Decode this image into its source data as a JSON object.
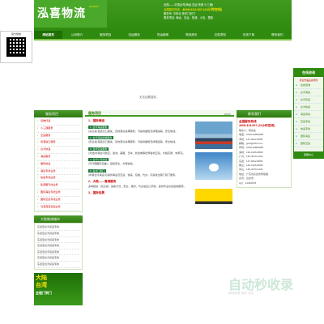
{
  "header": {
    "logo": "泓喜物流",
    "logo_sub": "HONGXI",
    "line1": "全国——中国台湾(海运 空运 快递 小三通)",
    "line2": "全国服务热线：",
    "phone": "4008-313-007 (24小时在线)",
    "line3": "服务号: 中转仓 快件门到门",
    "line4": "服务项目: 海运、空运、快递、小包、整柜"
  },
  "nav": [
    "网站首页",
    "公司简介",
    "服务项目",
    "空运服务",
    "货运新闻",
    "物流资讯",
    "交易须知",
    "在线下单",
    "联系我们"
  ],
  "qr": {
    "title": "官方微信"
  },
  "ad": {
    "text": "无法加载插件。"
  },
  "sidebar": {
    "title": "服务项目",
    "items": [
      "货物托运",
      "小三通服务",
      "空运服务",
      "香港进口服务",
      "台湾快递",
      "海运服务",
      "国际快递",
      "海运专线业务",
      "快递专线业务",
      "集装箱专线业务",
      "国际海运专线业务",
      "国际空运专线业务",
      "马来西亚货运业务"
    ]
  },
  "cities": {
    "title": "大陆物流城市",
    "items": [
      "东莞至台湾货运专线",
      "东莞至台湾货运专线",
      "东莞至台湾货运专线",
      "东莞至台湾货运专线",
      "东莞至台湾货运专线",
      "东莞至台湾货运专线",
      "东莞至台湾货运专线"
    ]
  },
  "banner": {
    "line1": "大陆",
    "line2": "台湾",
    "sub": "全程门到门"
  },
  "center": {
    "title": "服务项目",
    "more": "MORE",
    "sec1": "1、国际海运",
    "tag1": "1. 台湾海运服务",
    "p1": "(双清关)包括出口报关、目的港清关等服务，可提供整柜及拼箱运输，安全快捷。",
    "tag2": "2. 台湾海运拼箱服务",
    "p2": "(双清关)包括出口报关、目的港清关等服务，可提供整柜及拼箱运输，安全快捷。",
    "tag3": "3. 台湾空运服务",
    "p3": "(大陆)中港台湾航空，澳洲、美国、日本、新加坡等世界各地空运，价格实惠、效率高。",
    "tag4": "4. 台湾小包快递",
    "p4": "(可代理国际包裹)，运输安全、方便快捷。",
    "tag5": "5. 台湾门到门",
    "p5": "(中港台湾海运)可提供海运及空运、快递、包税、代办，可提供全程门到门服务。",
    "sec2": "2、大陆——香港服务",
    "p6": "多种报关（双清关）运输方式，安全、准时、代办进出口手续，提供专业化的运输服务。",
    "sec3": "3、国际包裹"
  },
  "right": {
    "title": "联系我们",
    "hotline_label": "全国服务热线",
    "hotline": "4008-313-007 (24小时在线)",
    "lines": [
      "联系人：陈先生",
      "电话：0769-22854008",
      "手机：137-9512-8056",
      "邮箱：gobi@163.com",
      "传真：0769-22854008",
      "深圳：136-1945-8068",
      "广州：135-4070-1234",
      "东莞：137-9512-8056",
      "佛山：136-1945-8068",
      "中山：135-4070-1234",
      "地址：广东省东莞市厚街镇",
      "台湾：台北市",
      "QQ：12345678"
    ]
  },
  "float": {
    "title": "在线咨询",
    "sub": "欢迎光临泓喜物流",
    "items": [
      "在线咨询",
      "台湾海运",
      "台湾空运",
      "台湾快递",
      "海运专线",
      "空运专线",
      "快递专线",
      "国际海运",
      "国际空运"
    ],
    "foot": "客服中心"
  },
  "watermark": {
    "text": "自动秒收录",
    "sub": "即时收录·来访·关注"
  }
}
